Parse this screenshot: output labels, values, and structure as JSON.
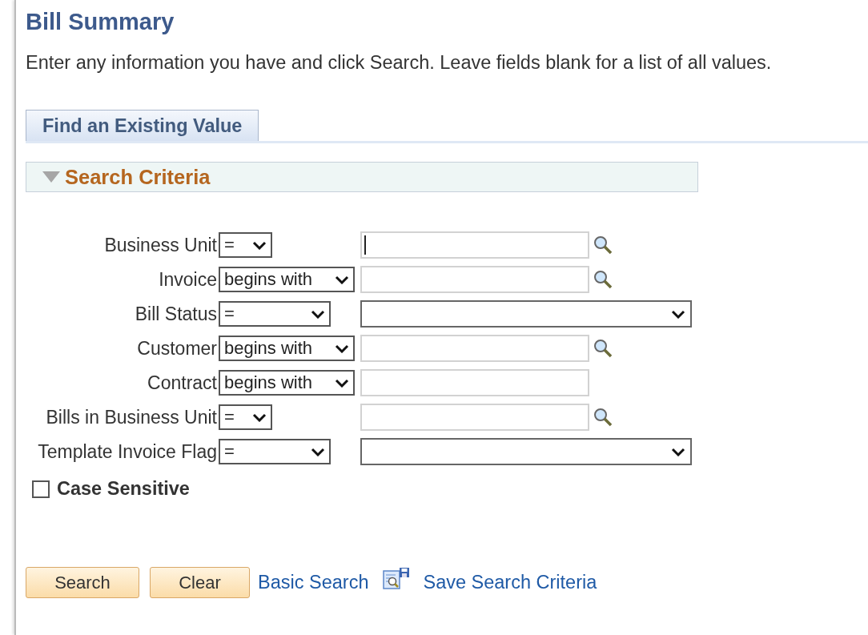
{
  "page_title": "Bill Summary",
  "instructions": "Enter any information you have and click Search. Leave fields blank for a list of all values.",
  "tabs": [
    {
      "label": "Find an Existing Value",
      "selected": true
    }
  ],
  "section": {
    "title": "Search Criteria",
    "expanded": true
  },
  "fields": [
    {
      "label": "Business Unit",
      "operator": "=",
      "kind": "text",
      "lookup": true,
      "focused": true
    },
    {
      "label": "Invoice",
      "operator": "begins with",
      "kind": "text",
      "lookup": true,
      "focused": false
    },
    {
      "label": "Bill Status",
      "operator": "=",
      "kind": "select",
      "lookup": false,
      "focused": false
    },
    {
      "label": "Customer",
      "operator": "begins with",
      "kind": "text",
      "lookup": true,
      "focused": false
    },
    {
      "label": "Contract",
      "operator": "begins with",
      "kind": "text",
      "lookup": false,
      "focused": false
    },
    {
      "label": "Bills in Business Unit",
      "operator": "=",
      "kind": "text",
      "lookup": true,
      "focused": false
    },
    {
      "label": "Template Invoice Flag",
      "operator": "=",
      "kind": "select",
      "lookup": false,
      "focused": false
    }
  ],
  "case_sensitive": {
    "label": "Case Sensitive",
    "checked": false
  },
  "buttons": [
    "Search",
    "Clear"
  ],
  "links": [
    {
      "label": "Basic Search",
      "kind": "plain"
    },
    {
      "label": "Save Search Criteria",
      "kind": "save"
    }
  ]
}
